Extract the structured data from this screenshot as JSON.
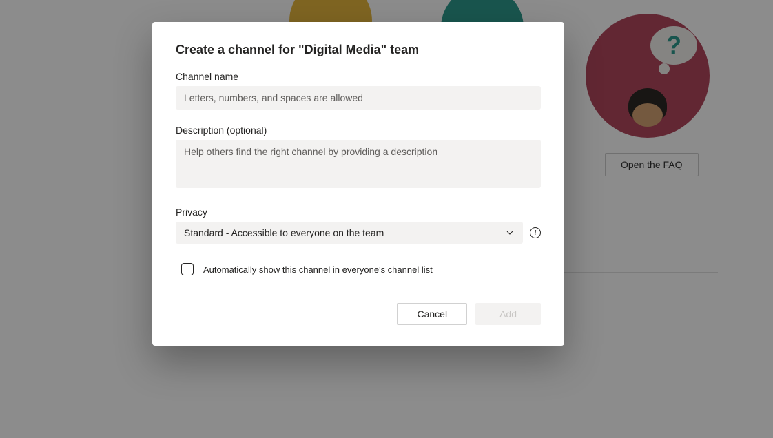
{
  "dialog": {
    "title": "Create a channel for \"Digital Media\" team",
    "channel_name": {
      "label": "Channel name",
      "placeholder": "Letters, numbers, and spaces are allowed",
      "value": ""
    },
    "description": {
      "label": "Description (optional)",
      "placeholder": "Help others find the right channel by providing a description",
      "value": ""
    },
    "privacy": {
      "label": "Privacy",
      "selected": "Standard - Accessible to everyone on the team"
    },
    "checkbox": {
      "label": "Automatically show this channel in everyone's channel list",
      "checked": false
    },
    "buttons": {
      "cancel": "Cancel",
      "add": "Add"
    }
  },
  "background": {
    "faq_button": "Open the FAQ",
    "question_mark": "?"
  }
}
